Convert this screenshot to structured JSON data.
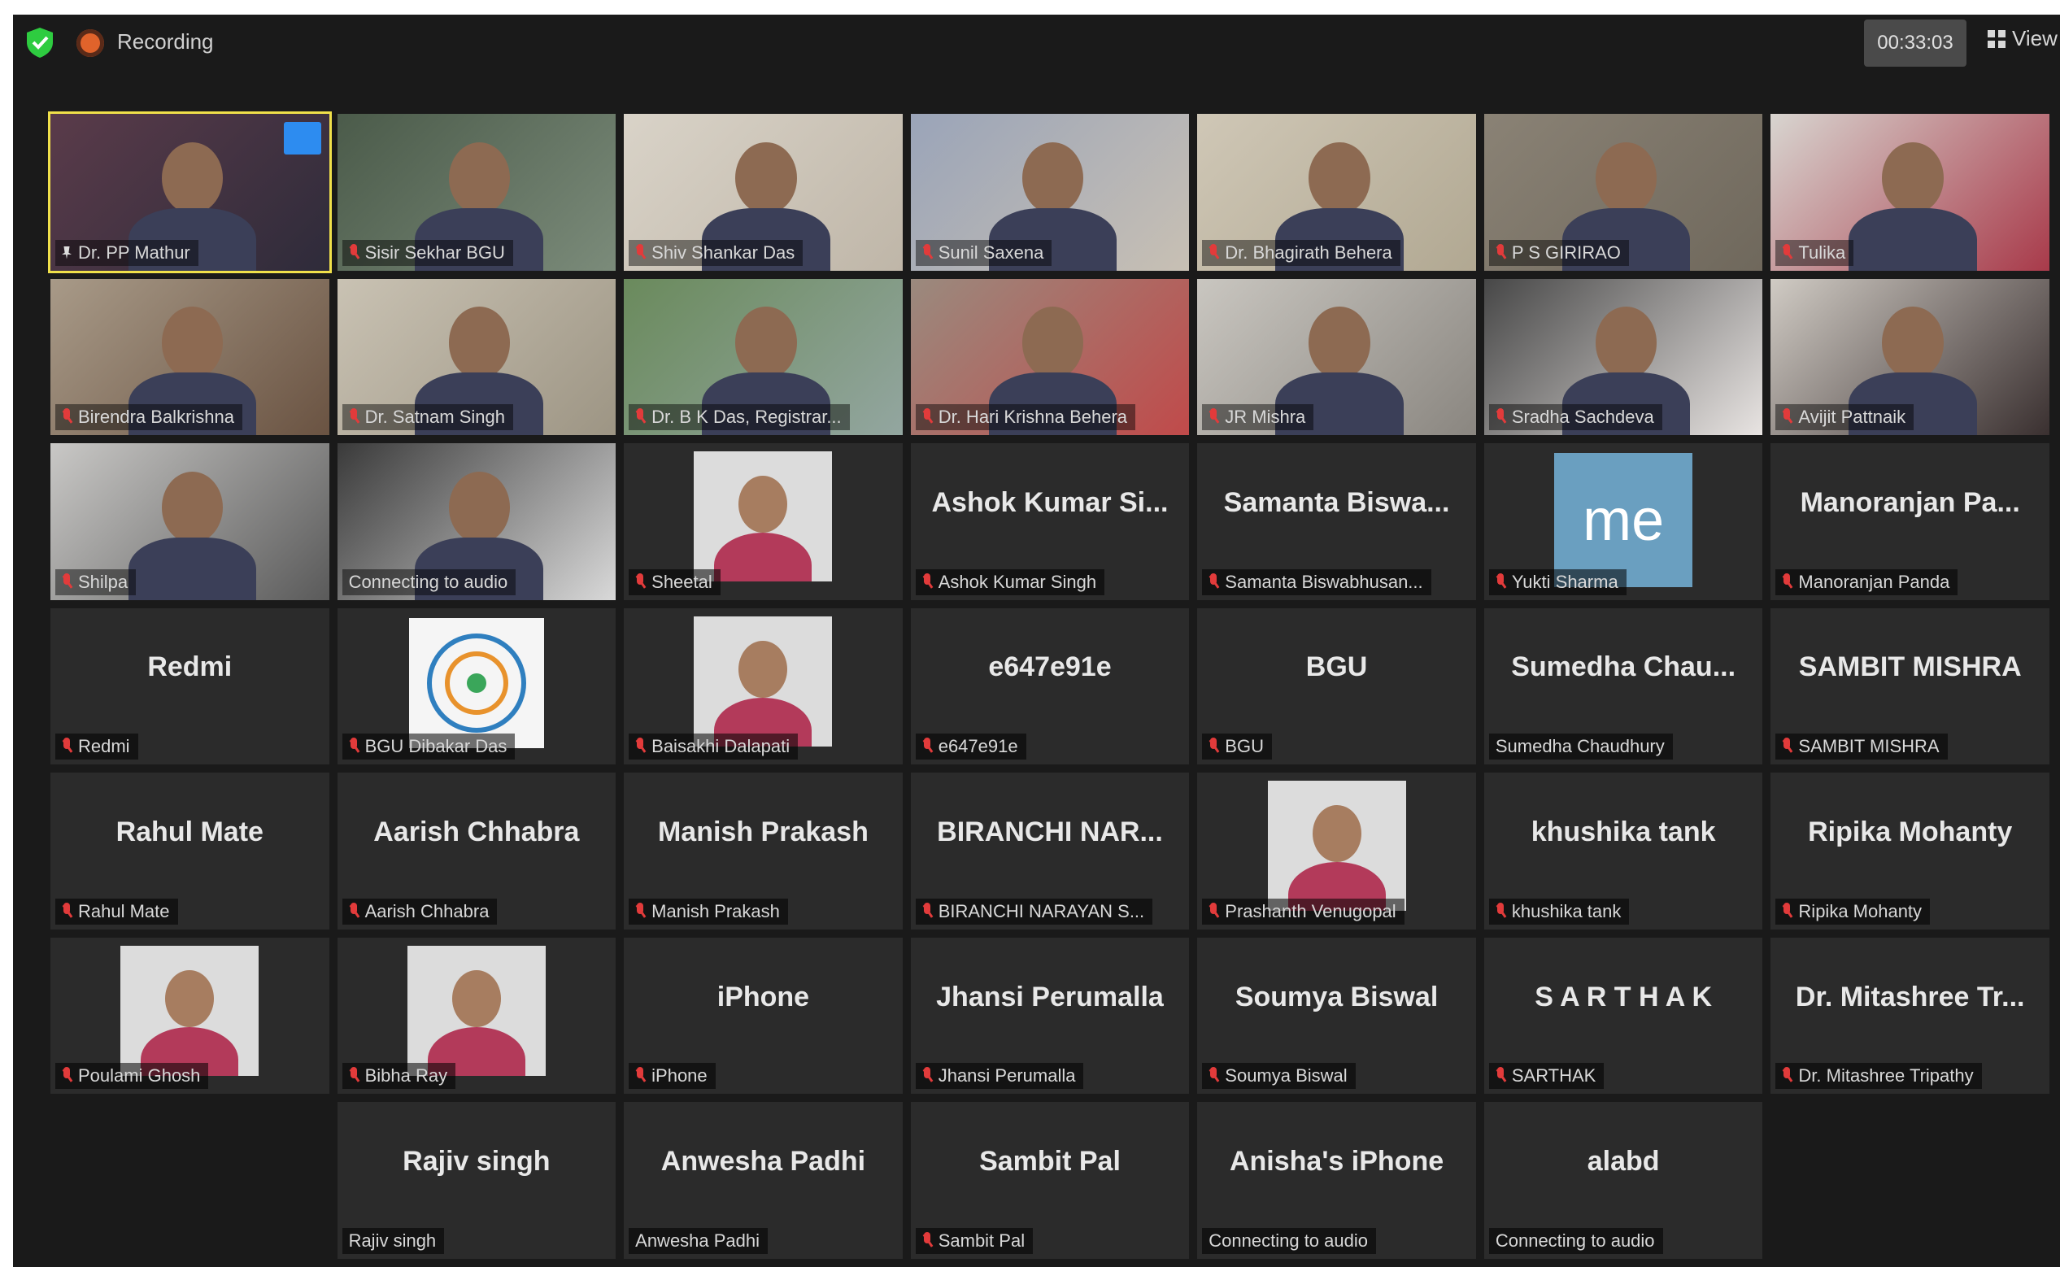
{
  "topbar": {
    "recording_label": "Recording",
    "timer": "00:33:03",
    "view_label": "View"
  },
  "colors": {
    "background": "#1a1a1a",
    "tile": "#2b2b2b",
    "active_speaker": "#f0e04a",
    "recording": "#e0632b",
    "shield": "#2ecc40",
    "muted_mic": "#e23b3b"
  },
  "participants": [
    {
      "tag": "Dr. PP Mathur",
      "type": "video",
      "active": true
    },
    {
      "tag": "Sisir Sekhar BGU",
      "type": "video"
    },
    {
      "tag": "Shiv Shankar Das",
      "type": "video"
    },
    {
      "tag": "Sunil Saxena",
      "type": "video"
    },
    {
      "tag": "Dr. Bhagirath Behera",
      "type": "video"
    },
    {
      "tag": "P S GIRIRAO",
      "type": "video"
    },
    {
      "tag": "Tulika",
      "type": "video"
    },
    {
      "tag": "Birendra Balkrishna",
      "type": "video"
    },
    {
      "tag": "Dr. Satnam Singh",
      "type": "video"
    },
    {
      "tag": "Dr. B K Das, Registrar...",
      "type": "video"
    },
    {
      "tag": "Dr. Hari Krishna Behera",
      "type": "video"
    },
    {
      "tag": "JR Mishra",
      "type": "video"
    },
    {
      "tag": "Sradha Sachdeva",
      "type": "video"
    },
    {
      "tag": "Avijit Pattnaik",
      "type": "video"
    },
    {
      "tag": "Shilpa",
      "type": "video"
    },
    {
      "tag": "Connecting to audio",
      "type": "video",
      "connecting": true
    },
    {
      "tag": "Sheetal",
      "type": "photo"
    },
    {
      "tag": "Ashok Kumar Singh",
      "big": "Ashok Kumar Si...",
      "type": "name"
    },
    {
      "tag": "Samanta Biswabhusan...",
      "big": "Samanta Biswa...",
      "type": "name"
    },
    {
      "tag": "Yukti Sharma",
      "type": "me",
      "me_text": "me"
    },
    {
      "tag": "Manoranjan Panda",
      "big": "Manoranjan Pa...",
      "type": "name"
    },
    {
      "tag": "Redmi",
      "big": "Redmi",
      "type": "name"
    },
    {
      "tag": "BGU Dibakar Das",
      "type": "logo"
    },
    {
      "tag": "Baisakhi Dalapati",
      "type": "photo"
    },
    {
      "tag": "e647e91e",
      "big": "e647e91e",
      "type": "name"
    },
    {
      "tag": "BGU",
      "big": "BGU",
      "type": "name"
    },
    {
      "tag": "Sumedha Chaudhury",
      "big": "Sumedha Chau...",
      "type": "name",
      "nomic": true
    },
    {
      "tag": "SAMBIT MISHRA",
      "big": "SAMBIT MISHRA",
      "type": "name"
    },
    {
      "tag": "Rahul Mate",
      "big": "Rahul Mate",
      "type": "name"
    },
    {
      "tag": "Aarish Chhabra",
      "big": "Aarish Chhabra",
      "type": "name"
    },
    {
      "tag": "Manish Prakash",
      "big": "Manish Prakash",
      "type": "name"
    },
    {
      "tag": "BIRANCHI NARAYAN S...",
      "big": "BIRANCHI NAR...",
      "type": "name"
    },
    {
      "tag": "Prashanth Venugopal",
      "type": "photo"
    },
    {
      "tag": "khushika tank",
      "big": "khushika tank",
      "type": "name"
    },
    {
      "tag": "Ripika Mohanty",
      "big": "Ripika Mohanty",
      "type": "name"
    },
    {
      "tag": "Poulami Ghosh",
      "type": "photo"
    },
    {
      "tag": "Bibha Ray",
      "type": "photo"
    },
    {
      "tag": "iPhone",
      "big": "iPhone",
      "type": "name"
    },
    {
      "tag": "Jhansi Perumalla",
      "big": "Jhansi Perumalla",
      "type": "name"
    },
    {
      "tag": "Soumya Biswal",
      "big": "Soumya Biswal",
      "type": "name"
    },
    {
      "tag": "SARTHAK",
      "big": "S A R T H A K",
      "type": "name"
    },
    {
      "tag": "Dr. Mitashree Tripathy",
      "big": "Dr. Mitashree Tr...",
      "type": "name"
    },
    {
      "type": "empty"
    },
    {
      "tag": "Rajiv singh",
      "big": "Rajiv singh",
      "type": "name",
      "nomic": true
    },
    {
      "tag": "Anwesha Padhi",
      "big": "Anwesha Padhi",
      "type": "name",
      "nomic": true
    },
    {
      "tag": "Sambit Pal",
      "big": "Sambit Pal",
      "type": "name"
    },
    {
      "tag": "Connecting to audio",
      "big": "Anisha's iPhone",
      "type": "name",
      "nomic": true
    },
    {
      "tag": "Connecting to audio",
      "big": "alabd",
      "type": "name",
      "nomic": true
    },
    {
      "type": "empty"
    }
  ]
}
